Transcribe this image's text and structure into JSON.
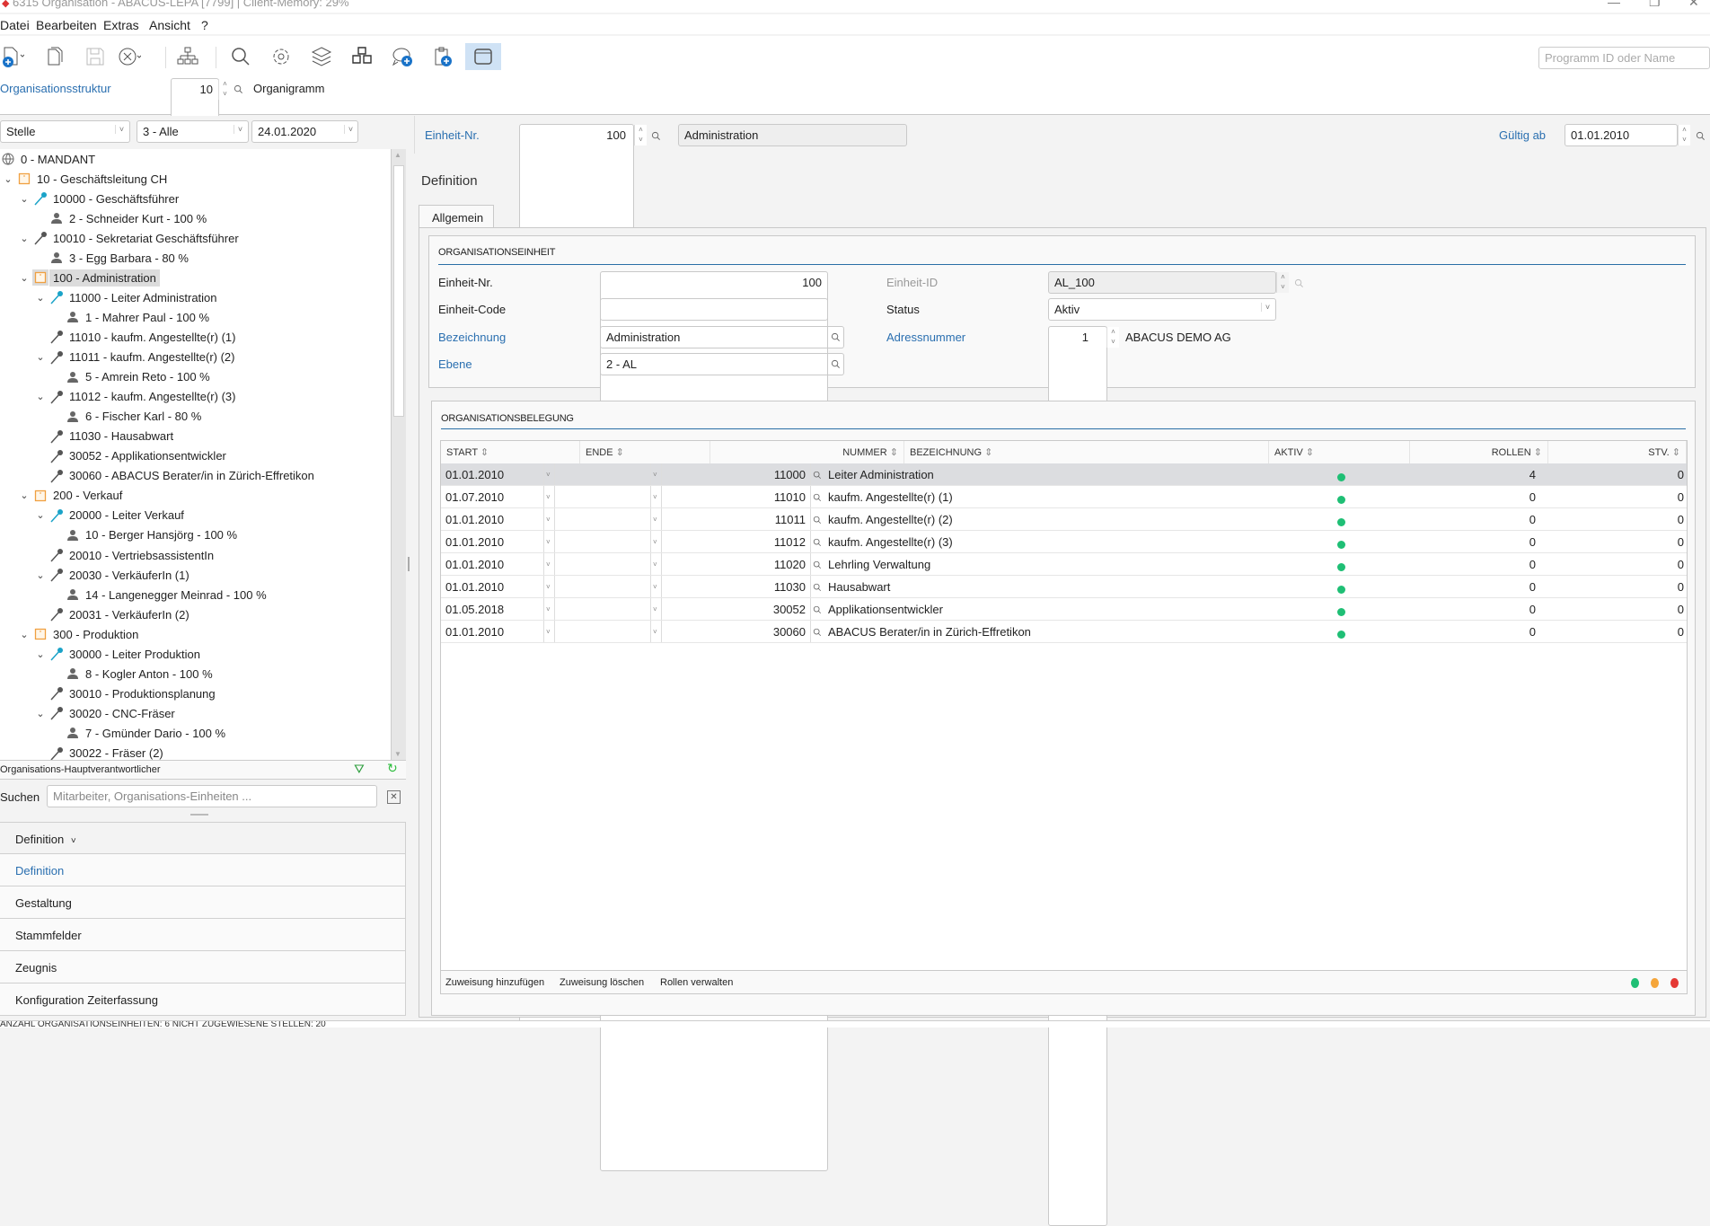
{
  "window": {
    "title": "6315 Organisation - ABACUS-LEPA [7799] | Client-Memory: 29%"
  },
  "menu": [
    "Datei",
    "Bearbeiten",
    "Extras",
    "Ansicht",
    "?"
  ],
  "toolbar": {
    "icons": [
      "new-document-icon",
      "copy-icon",
      "save-icon",
      "cancel-icon",
      "org-chart-icon",
      "search-icon",
      "gear-icon",
      "layers-icon",
      "cubes-icon",
      "add-comment-icon",
      "add-clipboard-icon",
      "window-icon"
    ],
    "program_search_placeholder": "Programm ID oder Name"
  },
  "structure": {
    "label": "Organisationsstruktur",
    "number": "10",
    "name": "Organigramm"
  },
  "filters": {
    "type": "Stelle",
    "level": "3 - Alle",
    "date": "24.01.2020"
  },
  "tree": [
    {
      "level": 0,
      "icon": "globe",
      "label": "0 - MANDANT"
    },
    {
      "level": 1,
      "icon": "unit",
      "expanded": true,
      "label": "10 - Geschäftsleitung CH"
    },
    {
      "level": 2,
      "icon": "leader",
      "expanded": true,
      "label": "10000 - Geschäftsführer"
    },
    {
      "level": 3,
      "icon": "person",
      "label": "2 - Schneider Kurt - 100 %"
    },
    {
      "level": 2,
      "icon": "position",
      "expanded": true,
      "label": "10010 - Sekretariat Geschäftsführer"
    },
    {
      "level": 3,
      "icon": "person",
      "label": "3 - Egg Barbara - 80 %"
    },
    {
      "level": 2,
      "icon": "unit",
      "expanded": true,
      "selected": true,
      "label": "100 - Administration"
    },
    {
      "level": 3,
      "icon": "leader",
      "expanded": true,
      "label": "11000 - Leiter Administration"
    },
    {
      "level": 4,
      "icon": "person",
      "label": "1 - Mahrer Paul - 100 %"
    },
    {
      "level": 3,
      "icon": "position",
      "label": "11010 - kaufm. Angestellte(r) (1)"
    },
    {
      "level": 3,
      "icon": "position",
      "expanded": true,
      "label": "11011 - kaufm. Angestellte(r) (2)"
    },
    {
      "level": 4,
      "icon": "person",
      "label": "5 - Amrein Reto - 100 %"
    },
    {
      "level": 3,
      "icon": "position",
      "expanded": true,
      "label": "11012 - kaufm. Angestellte(r) (3)"
    },
    {
      "level": 4,
      "icon": "person",
      "label": "6 - Fischer Karl - 80 %"
    },
    {
      "level": 3,
      "icon": "position",
      "label": "11030 - Hausabwart"
    },
    {
      "level": 3,
      "icon": "position",
      "label": "30052 - Applikationsentwickler"
    },
    {
      "level": 3,
      "icon": "position",
      "label": "30060 - ABACUS Berater/in in Zürich-Effretikon"
    },
    {
      "level": 2,
      "icon": "unit",
      "expanded": true,
      "label": "200 - Verkauf"
    },
    {
      "level": 3,
      "icon": "leader",
      "expanded": true,
      "label": "20000 - Leiter Verkauf"
    },
    {
      "level": 4,
      "icon": "person",
      "label": "10 - Berger Hansjörg - 100 %"
    },
    {
      "level": 3,
      "icon": "position",
      "label": "20010 - VertriebsassistentIn"
    },
    {
      "level": 3,
      "icon": "position",
      "expanded": true,
      "label": "20030 - VerkäuferIn (1)"
    },
    {
      "level": 4,
      "icon": "person",
      "label": "14 - Langenegger Meinrad - 100 %"
    },
    {
      "level": 3,
      "icon": "position",
      "label": "20031 - VerkäuferIn (2)"
    },
    {
      "level": 2,
      "icon": "unit",
      "expanded": true,
      "label": "300 - Produktion"
    },
    {
      "level": 3,
      "icon": "leader",
      "expanded": true,
      "label": "30000 - Leiter Produktion"
    },
    {
      "level": 4,
      "icon": "person",
      "label": "8 - Kogler Anton - 100 %"
    },
    {
      "level": 3,
      "icon": "position",
      "label": "30010 - Produktionsplanung"
    },
    {
      "level": 3,
      "icon": "position",
      "expanded": true,
      "label": "30020 - CNC-Fräser"
    },
    {
      "level": 4,
      "icon": "person",
      "label": "7 - Gmünder Dario - 100 %"
    },
    {
      "level": 3,
      "icon": "position",
      "label": "30022 - Fräser (2)"
    }
  ],
  "tree_footer": {
    "label": "Organisations-Hauptverantwortlicher"
  },
  "search": {
    "label": "Suchen",
    "placeholder": "Mitarbeiter, Organisations-Einheiten ..."
  },
  "nav": {
    "header": "Definition",
    "items": [
      "Definition",
      "Gestaltung",
      "Stammfelder",
      "Zeugnis",
      "Konfiguration Zeiterfassung"
    ],
    "active": 0
  },
  "header": {
    "unit_label": "Einheit-Nr.",
    "unit_value": "100",
    "unit_name": "Administration",
    "valid_label": "Gültig ab",
    "valid_value": "01.01.2010"
  },
  "section_title": "Definition",
  "tab": "Allgemein",
  "orgunit": {
    "title": "ORGANISATIONSEINHEIT",
    "nr_label": "Einheit-Nr.",
    "nr_value": "100",
    "code_label": "Einheit-Code",
    "code_value": "",
    "name_label": "Bezeichnung",
    "name_value": "Administration",
    "level_label": "Ebene",
    "level_value": "2 - AL",
    "id_label": "Einheit-ID",
    "id_value": "AL_100",
    "status_label": "Status",
    "status_value": "Aktiv",
    "address_label": "Adressnummer",
    "address_value": "1",
    "address_name": "ABACUS DEMO AG"
  },
  "assignment": {
    "title": "ORGANISATIONSBELEGUNG",
    "columns": [
      "START",
      "ENDE",
      "NUMMER",
      "BEZEICHNUNG",
      "AKTIV",
      "ROLLEN",
      "STV."
    ],
    "rows": [
      {
        "start": "01.01.2010",
        "end": "",
        "number": "11000",
        "name": "Leiter Administration",
        "active": true,
        "roles": "4",
        "stv": "0"
      },
      {
        "start": "01.07.2010",
        "end": "",
        "number": "11010",
        "name": "kaufm. Angestellte(r) (1)",
        "active": true,
        "roles": "0",
        "stv": "0"
      },
      {
        "start": "01.01.2010",
        "end": "",
        "number": "11011",
        "name": "kaufm. Angestellte(r) (2)",
        "active": true,
        "roles": "0",
        "stv": "0"
      },
      {
        "start": "01.01.2010",
        "end": "",
        "number": "11012",
        "name": "kaufm. Angestellte(r) (3)",
        "active": true,
        "roles": "0",
        "stv": "0"
      },
      {
        "start": "01.01.2010",
        "end": "",
        "number": "11020",
        "name": "Lehrling Verwaltung",
        "active": true,
        "roles": "0",
        "stv": "0"
      },
      {
        "start": "01.01.2010",
        "end": "",
        "number": "11030",
        "name": "Hausabwart",
        "active": true,
        "roles": "0",
        "stv": "0"
      },
      {
        "start": "01.05.2018",
        "end": "",
        "number": "30052",
        "name": "Applikationsentwickler",
        "active": true,
        "roles": "0",
        "stv": "0"
      },
      {
        "start": "01.01.2010",
        "end": "",
        "number": "30060",
        "name": "ABACUS Berater/in in Zürich-Effretikon",
        "active": true,
        "roles": "0",
        "stv": "0"
      }
    ],
    "actions": [
      "Zuweisung hinzufügen",
      "Zuweisung löschen",
      "Rollen verwalten"
    ],
    "legend_colors": [
      "#1fbf75",
      "#f5a53a",
      "#e53935"
    ]
  },
  "statusbar": "ANZAHL ORGANISATIONSEINHEITEN: 6    NICHT ZUGEWIESENE STELLEN: 20",
  "colors": {
    "accent": "#2a6fb0",
    "leader": "#1aa3c8",
    "unit": "#f0a040",
    "active": "#1fbf75"
  }
}
